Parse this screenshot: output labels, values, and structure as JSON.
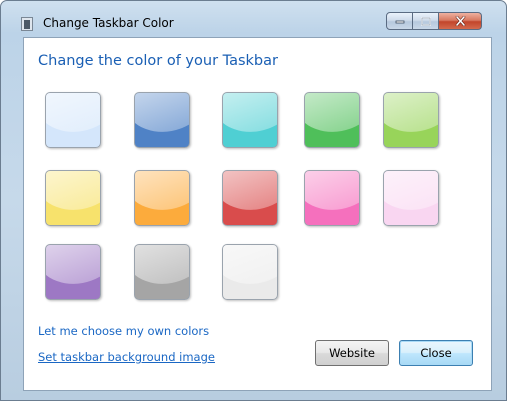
{
  "window": {
    "title": "Change Taskbar Color",
    "caption_buttons": [
      {
        "name": "minimize",
        "icon": "minimize-icon"
      },
      {
        "name": "maximize",
        "icon": "maximize-icon"
      },
      {
        "name": "close",
        "icon": "close-icon"
      }
    ]
  },
  "main": {
    "heading": "Change the color of your Taskbar",
    "swatches": [
      {
        "id": "sky",
        "color": "#d4e6fb"
      },
      {
        "id": "blue",
        "color": "#4f82c6"
      },
      {
        "id": "teal",
        "color": "#4fcfd3"
      },
      {
        "id": "green",
        "color": "#4fbf5a"
      },
      {
        "id": "lime",
        "color": "#98d45a"
      },
      {
        "id": "yellow",
        "color": "#f7e26c"
      },
      {
        "id": "orange",
        "color": "#fcab3c"
      },
      {
        "id": "red",
        "color": "#d94c4c"
      },
      {
        "id": "pink",
        "color": "#f570bd"
      },
      {
        "id": "light-pink",
        "color": "#f9d6f1"
      },
      {
        "id": "violet",
        "color": "#9d78c4"
      },
      {
        "id": "gray",
        "color": "#a5a5a5"
      },
      {
        "id": "white",
        "color": "#eaeaea"
      }
    ],
    "links": {
      "custom_colors": "Let me choose my own colors",
      "background_image": "Set taskbar background image"
    },
    "buttons": {
      "website": "Website",
      "close": "Close"
    }
  }
}
